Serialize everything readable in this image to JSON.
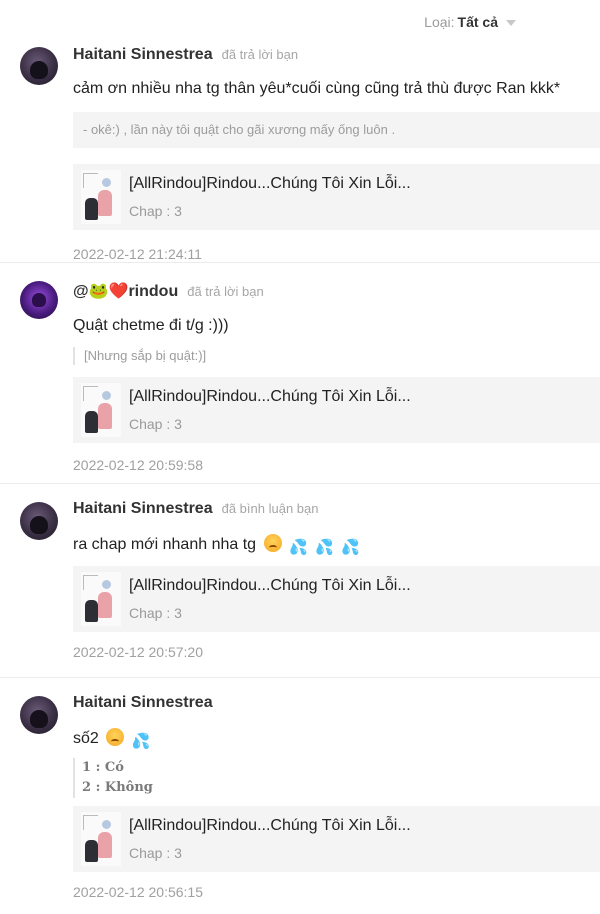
{
  "filter": {
    "label": "Loại:",
    "value": "Tất cả"
  },
  "items": [
    {
      "user": "Haitani Sinnestrea",
      "action": "đã trả lời bạn",
      "message": "cảm ơn nhiều nha tg thân yêu*cuối cùng cũng trả thù được Ran kkk*",
      "quote": "- okê:) , lần này tôi quật cho gãi xương mấy ống luôn .",
      "card_title": "[AllRindou]Rindou...Chúng Tôi Xin Lỗi...",
      "card_sub": "Chap : 3",
      "time": "2022-02-12 21:24:11"
    },
    {
      "user": "@🐸❤️rindou",
      "action": "đã trả lời bạn",
      "message": "Quật chetme đi t/g :)))",
      "quote": "[Nhưng sắp bị quật:)]",
      "card_title": "[AllRindou]Rindou...Chúng Tôi Xin Lỗi...",
      "card_sub": "Chap : 3",
      "time": "2022-02-12 20:59:58"
    },
    {
      "user": "Haitani Sinnestrea",
      "action": "đã bình luận bạn",
      "message": "ra chap mới nhanh nha tg",
      "card_title": "[AllRindou]Rindou...Chúng Tôi Xin Lỗi...",
      "card_sub": "Chap : 3",
      "time": "2022-02-12 20:57:20"
    },
    {
      "user": "Haitani Sinnestrea",
      "action": "",
      "message": "số2",
      "poll": [
        "1 : Có",
        "2 : Không"
      ],
      "card_title": "[AllRindou]Rindou...Chúng Tôi Xin Lỗi...",
      "card_sub": "Chap : 3",
      "time": "2022-02-12 20:56:15"
    }
  ],
  "emoji": {
    "angry": "😖",
    "drops": "💦"
  },
  "colors": {
    "muted": "#a6a6a6",
    "card_bg": "#f4f4f4",
    "divider": "#ececec"
  }
}
